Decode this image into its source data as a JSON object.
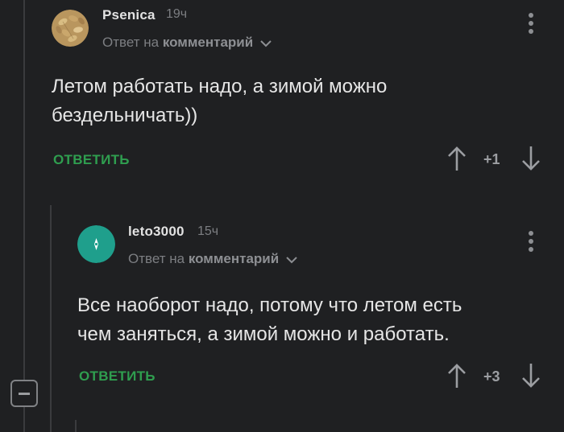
{
  "colors": {
    "background": "#1f2022",
    "accent": "#2f9e4f",
    "muted": "#7c7e82"
  },
  "comments": [
    {
      "username": "Psenica",
      "time": "19ч",
      "reply_prefix": "Ответ на",
      "reply_target": "комментарий",
      "text_lines": [
        "Летом работать надо, а зимой можно",
        "бездельничать))"
      ],
      "reply_label": "ОТВЕТИТЬ",
      "score": "+1",
      "avatar": "wheat-grain-avatar"
    },
    {
      "username": "leto3000",
      "time": "15ч",
      "reply_prefix": "Ответ на",
      "reply_target": "комментарий",
      "text_lines": [
        "Все наоборот надо, потому что летом есть",
        "чем заняться, а зимой можно и работать."
      ],
      "reply_label": "ОТВЕТИТЬ",
      "score": "+3",
      "avatar": "teal-default-avatar"
    }
  ],
  "icons": {
    "upvote": "arrow-up-icon",
    "downvote": "arrow-down-icon",
    "menu": "kebab-menu-icon",
    "collapse": "minus-collapse-icon"
  }
}
